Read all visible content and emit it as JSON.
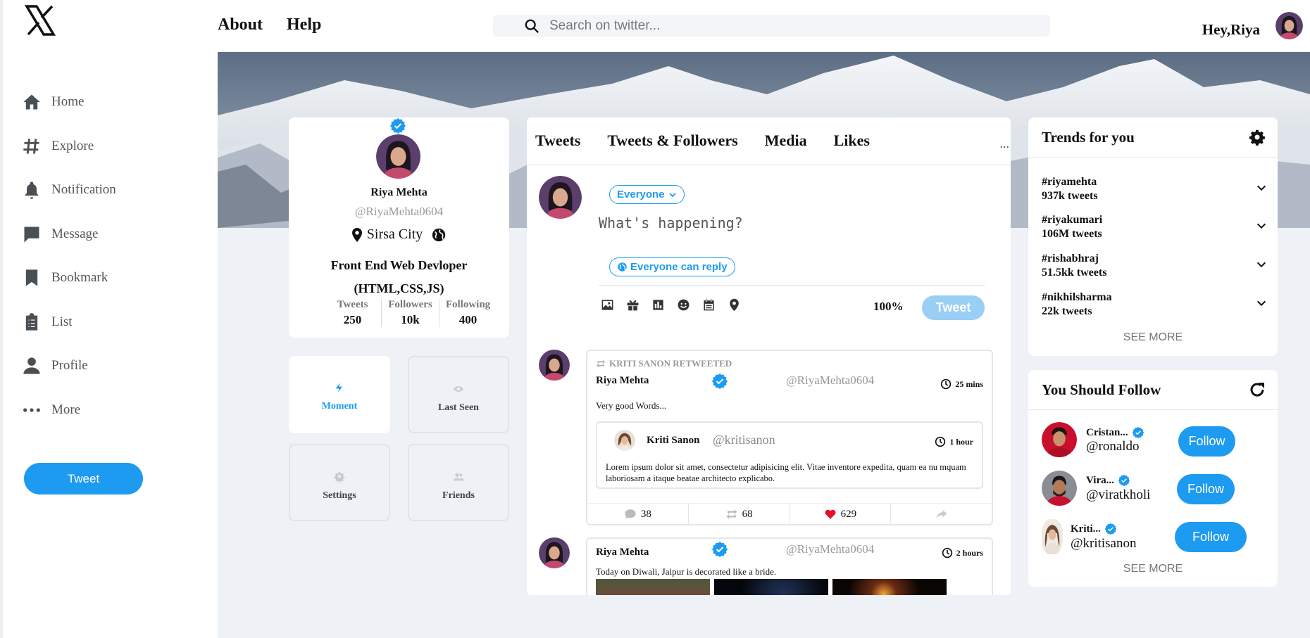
{
  "sidebar": {
    "items": [
      {
        "label": "Home",
        "icon": "home-icon"
      },
      {
        "label": "Explore",
        "icon": "hashtag-icon"
      },
      {
        "label": "Notification",
        "icon": "bell-icon"
      },
      {
        "label": "Message",
        "icon": "chat-icon"
      },
      {
        "label": "Bookmark",
        "icon": "bookmark-icon"
      },
      {
        "label": "List",
        "icon": "clipboard-list-icon"
      },
      {
        "label": "Profile",
        "icon": "user-icon"
      },
      {
        "label": "More",
        "icon": "dots-icon"
      }
    ],
    "tweet_button": "Tweet"
  },
  "header": {
    "about": "About",
    "help": "Help",
    "search_placeholder": "Search on twitter...",
    "greeting": "Hey,Riya"
  },
  "profile": {
    "name": "Riya Mehta",
    "handle": "@RiyaMehta0604",
    "location": "Sirsa City",
    "role_line1": "Front End Web Devloper",
    "role_line2": "(HTML,CSS,JS)",
    "stats": [
      {
        "label": "Tweets",
        "value": "250"
      },
      {
        "label": "Followers",
        "value": "10k"
      },
      {
        "label": "Following",
        "value": "400"
      }
    ]
  },
  "tiles": [
    {
      "label": "Moment",
      "icon": "bolt-icon"
    },
    {
      "label": "Last Seen",
      "icon": "eye-icon"
    },
    {
      "label": "Settings",
      "icon": "gear-icon"
    },
    {
      "label": "Friends",
      "icon": "users-icon"
    }
  ],
  "feed": {
    "tabs": [
      "Tweets",
      "Tweets & Followers",
      "Media",
      "Likes"
    ],
    "more": "...",
    "audience": "Everyone",
    "placeholder": "What's happening?",
    "reply_setting": "Everyone can reply",
    "percent": "100%",
    "tweet_button": "Tweet"
  },
  "posts": [
    {
      "retweeted_by": "KRITI SANON RETWEETED",
      "name": "Riya Mehta",
      "handle": "@RiyaMehta0604",
      "time": "25 mins",
      "text": "Very good Words...",
      "quote": {
        "name": "Kriti Sanon",
        "handle": "@kritisanon",
        "time": "1 hour",
        "text": "Lorem ipsum dolor sit amet, consectetur adipisicing elit. Vitae inventore expedita, quam ea nu mquam laboriosam a itaque beatae architecto explicabo."
      },
      "comments": "38",
      "retweets": "68",
      "likes": "629"
    },
    {
      "name": "Riya Mehta",
      "handle": "@RiyaMehta0604",
      "time": "2 hours",
      "text": "Today on Diwali, Jaipur is decorated like a bride."
    }
  ],
  "trends": {
    "title": "Trends for you",
    "items": [
      {
        "tag": "#riyamehta",
        "count": "937k tweets"
      },
      {
        "tag": "#riyakumari",
        "count": "106M tweets"
      },
      {
        "tag": "#rishabhraj",
        "count": "51.5kk tweets"
      },
      {
        "tag": "#nikhilsharma",
        "count": "22k tweets"
      }
    ],
    "see_more": "SEE MORE"
  },
  "follow": {
    "title": "You Should Follow",
    "items": [
      {
        "name": "Cristan...",
        "handle": "@ronaldo",
        "button": "Follow"
      },
      {
        "name": "Vira...",
        "handle": "@viratkholi",
        "button": "Follow"
      },
      {
        "name": "Kriti...",
        "handle": "@kritisanon",
        "button": "Follow"
      }
    ],
    "see_more": "SEE MORE"
  },
  "colors": {
    "accent": "#1d9bf0",
    "like": "#e0245e",
    "muted": "#999999",
    "background": "#eef1f5"
  }
}
